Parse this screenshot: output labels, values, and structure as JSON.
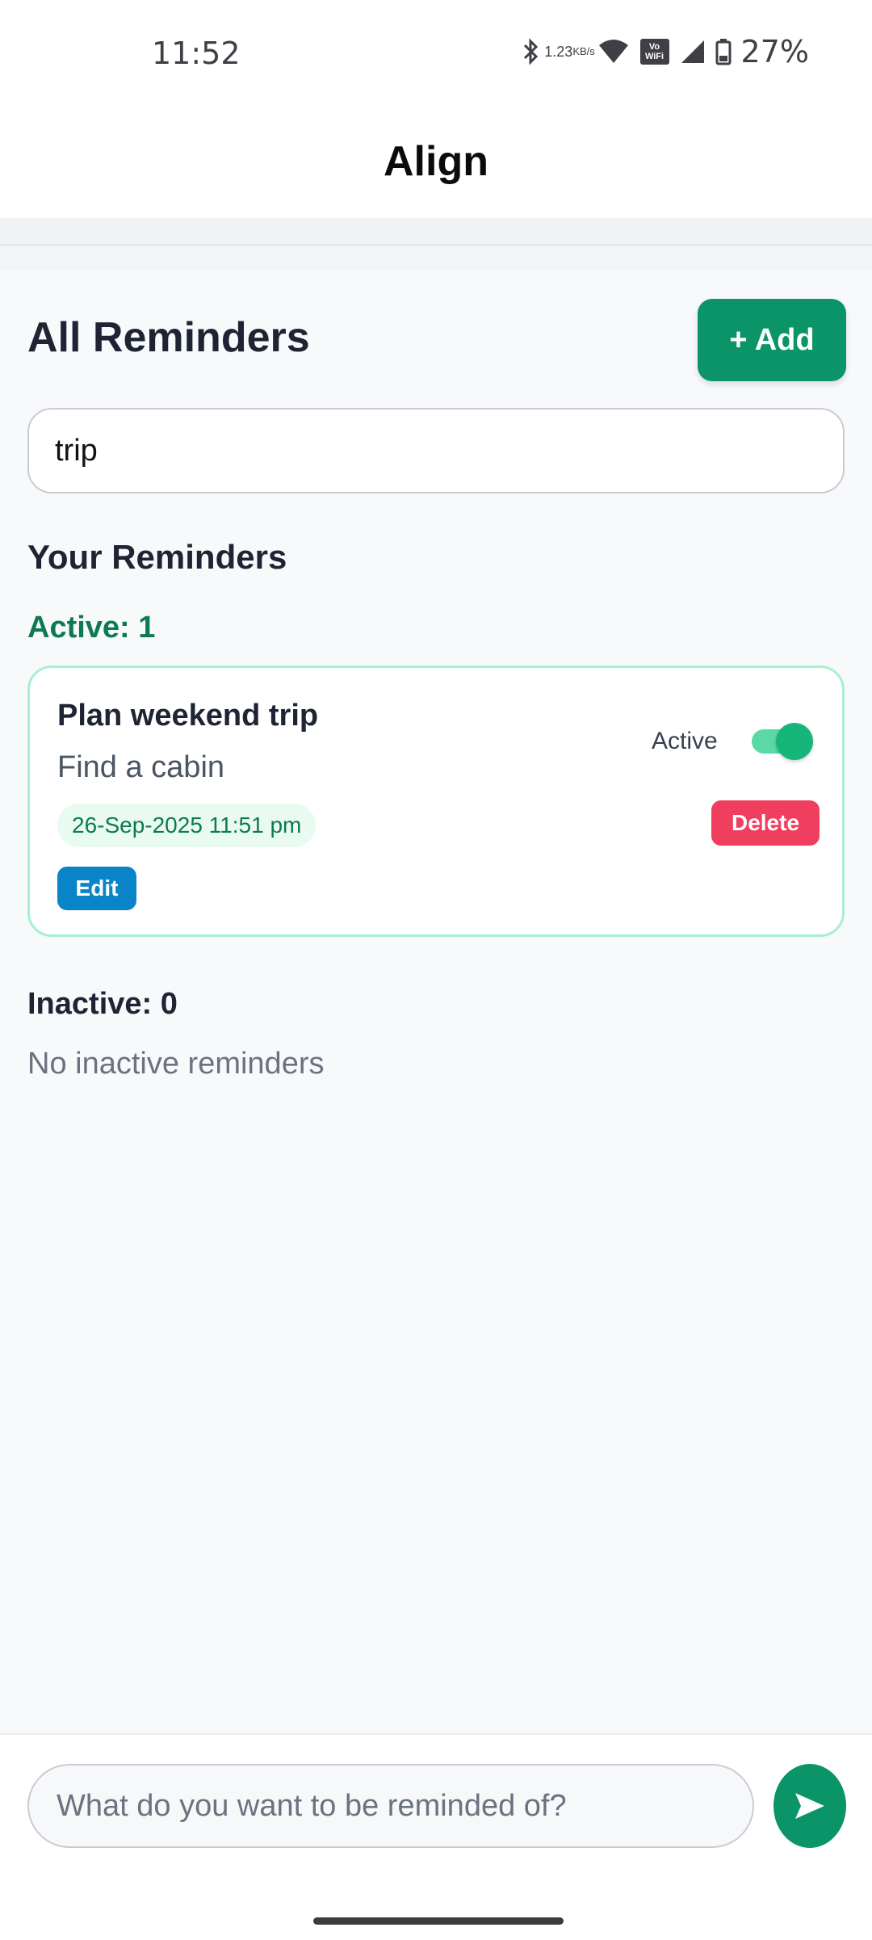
{
  "status_bar": {
    "time": "11:52",
    "net_speed_value": "1.23",
    "net_speed_unit": "KB/s",
    "volte_label_top": "Vo",
    "volte_label_bottom": "WiFi",
    "battery": "27%"
  },
  "app": {
    "title": "Align"
  },
  "header": {
    "title": "All Reminders",
    "add_label": "+ Add"
  },
  "search": {
    "value": "trip"
  },
  "reminders": {
    "section_title": "Your Reminders",
    "active_count_label": "Active: 1",
    "inactive_count_label": "Inactive: 0",
    "no_inactive_text": "No inactive reminders",
    "items": [
      {
        "title": "Plan weekend trip",
        "description": "Find a cabin",
        "datetime": "26-Sep-2025 11:51 pm",
        "status_label": "Active",
        "toggle_on": true,
        "edit_label": "Edit",
        "delete_label": "Delete"
      }
    ]
  },
  "composer": {
    "placeholder": "What do you want to be reminded of?"
  },
  "colors": {
    "primary": "#0a9467",
    "active_text": "#0c7a52",
    "card_border": "#a7efcf",
    "edit": "#0a84c8",
    "delete": "#ef3e5e",
    "toggle": "#16b67a"
  }
}
